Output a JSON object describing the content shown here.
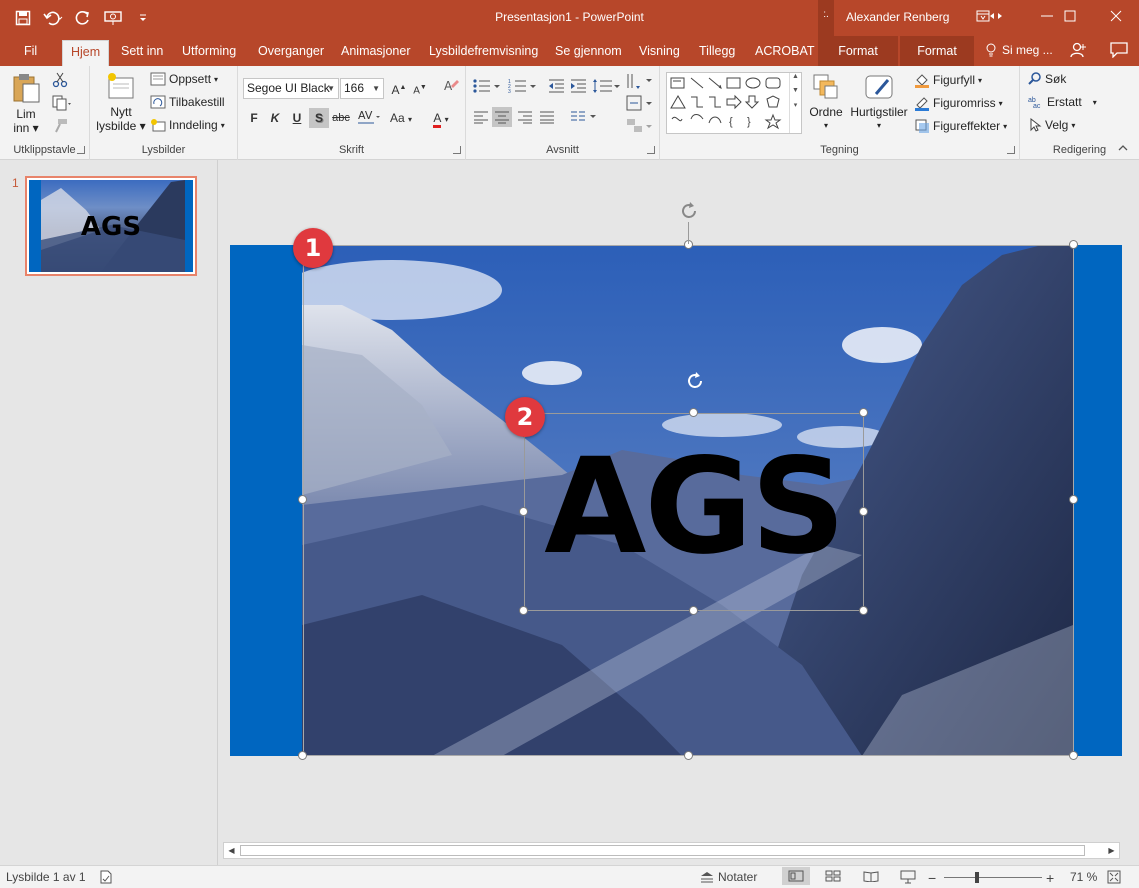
{
  "titlebar": {
    "title": "Presentasjon1 - PowerPoint",
    "user": "Alexander Renberg",
    "context_strip": ":.",
    "colors": {
      "brand": "#b7472a",
      "context": "#9c3a20"
    }
  },
  "tabs": {
    "file": "Fil",
    "home": "Hjem",
    "insert": "Sett inn",
    "design": "Utforming",
    "transitions": "Overganger",
    "animations": "Animasjoner",
    "slideshow": "Lysbildefremvisning",
    "review": "Se gjennom",
    "view": "Visning",
    "addins": "Tillegg",
    "acrobat": "ACROBAT",
    "format1": "Format",
    "format2": "Format",
    "tellme": "Si meg ..."
  },
  "ribbon": {
    "clipboard": {
      "label": "Utklippstavle",
      "paste_line1": "Lim",
      "paste_line2": "inn"
    },
    "slides": {
      "label": "Lysbilder",
      "new_line1": "Nytt",
      "new_line2": "lysbilde",
      "layout": "Oppsett",
      "reset": "Tilbakestill",
      "section": "Inndeling"
    },
    "font": {
      "label": "Skrift",
      "font_name": "Segoe UI Black",
      "font_size": "166",
      "bold": "F",
      "italic": "K",
      "underline": "U",
      "shadow": "S",
      "strike": "abc",
      "case": "Aa",
      "color_letter": "A"
    },
    "paragraph": {
      "label": "Avsnitt"
    },
    "drawing": {
      "label": "Tegning",
      "arrange": "Ordne",
      "quick_styles": "Hurtigstiler",
      "fill": "Figurfyll",
      "outline": "Figuromriss",
      "effects": "Figureffekter"
    },
    "editing": {
      "label": "Redigering",
      "find": "Søk",
      "replace": "Erstatt",
      "select": "Velg"
    }
  },
  "slides_panel": {
    "slide_number": "1",
    "thumb_text": "AGS"
  },
  "slide": {
    "text": "AGS",
    "background_color": "#0066c0",
    "callout1": "1",
    "callout2": "2"
  },
  "statusbar": {
    "slide_info": "Lysbilde 1 av 1",
    "notes": "Notater",
    "zoom": "71 %"
  }
}
